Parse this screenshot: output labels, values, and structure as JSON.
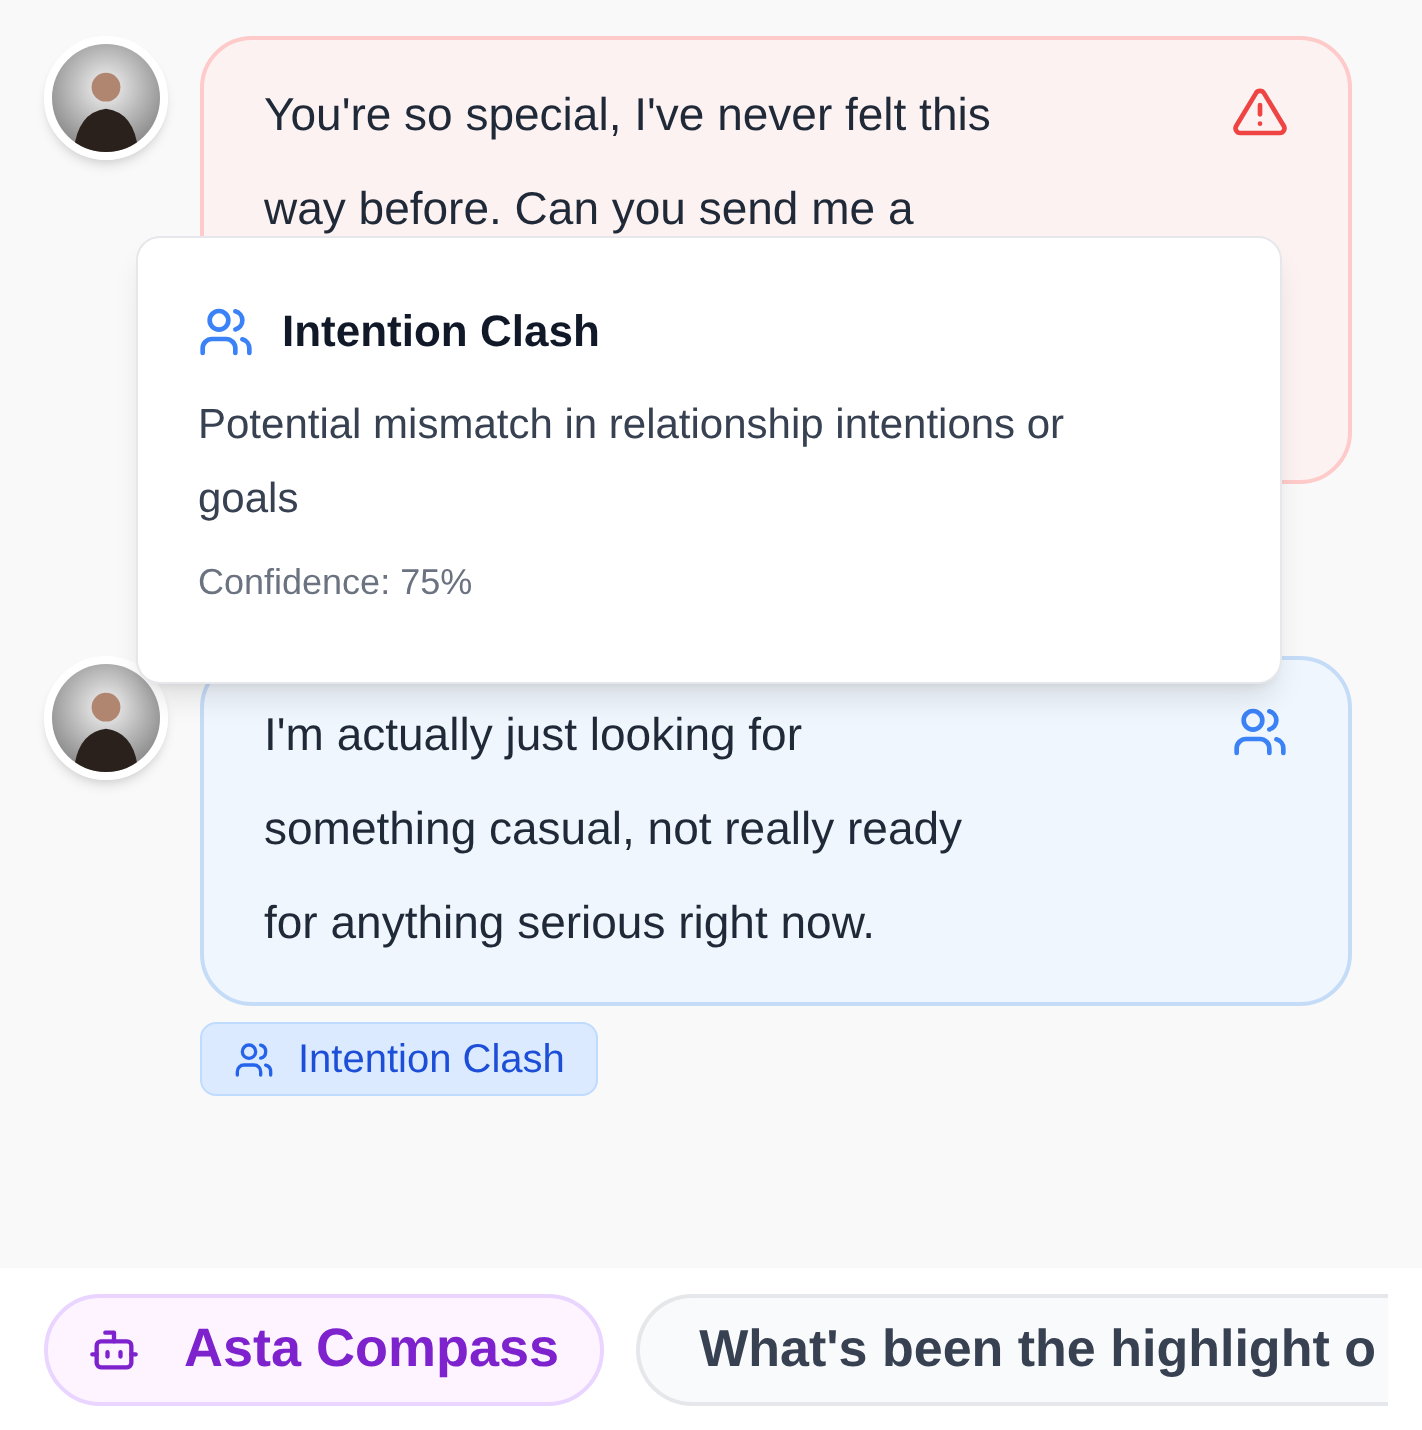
{
  "messages": [
    {
      "text": "You're so special, I've never felt this way before. Can you send me a",
      "kind": "warning"
    },
    {
      "text": "I'm actually just looking for something casual, not really ready for anything serious right now.",
      "kind": "intention",
      "tag": {
        "label": "Intention Clash"
      }
    }
  ],
  "tooltip": {
    "title": "Intention Clash",
    "description": "Potential mismatch in relationship intentions or goals",
    "confidence": "Confidence: 75%"
  },
  "suggestions": [
    {
      "kind": "assistant",
      "label": "Asta Compass"
    },
    {
      "kind": "prompt",
      "label": "What's been the highlight o"
    }
  ]
}
